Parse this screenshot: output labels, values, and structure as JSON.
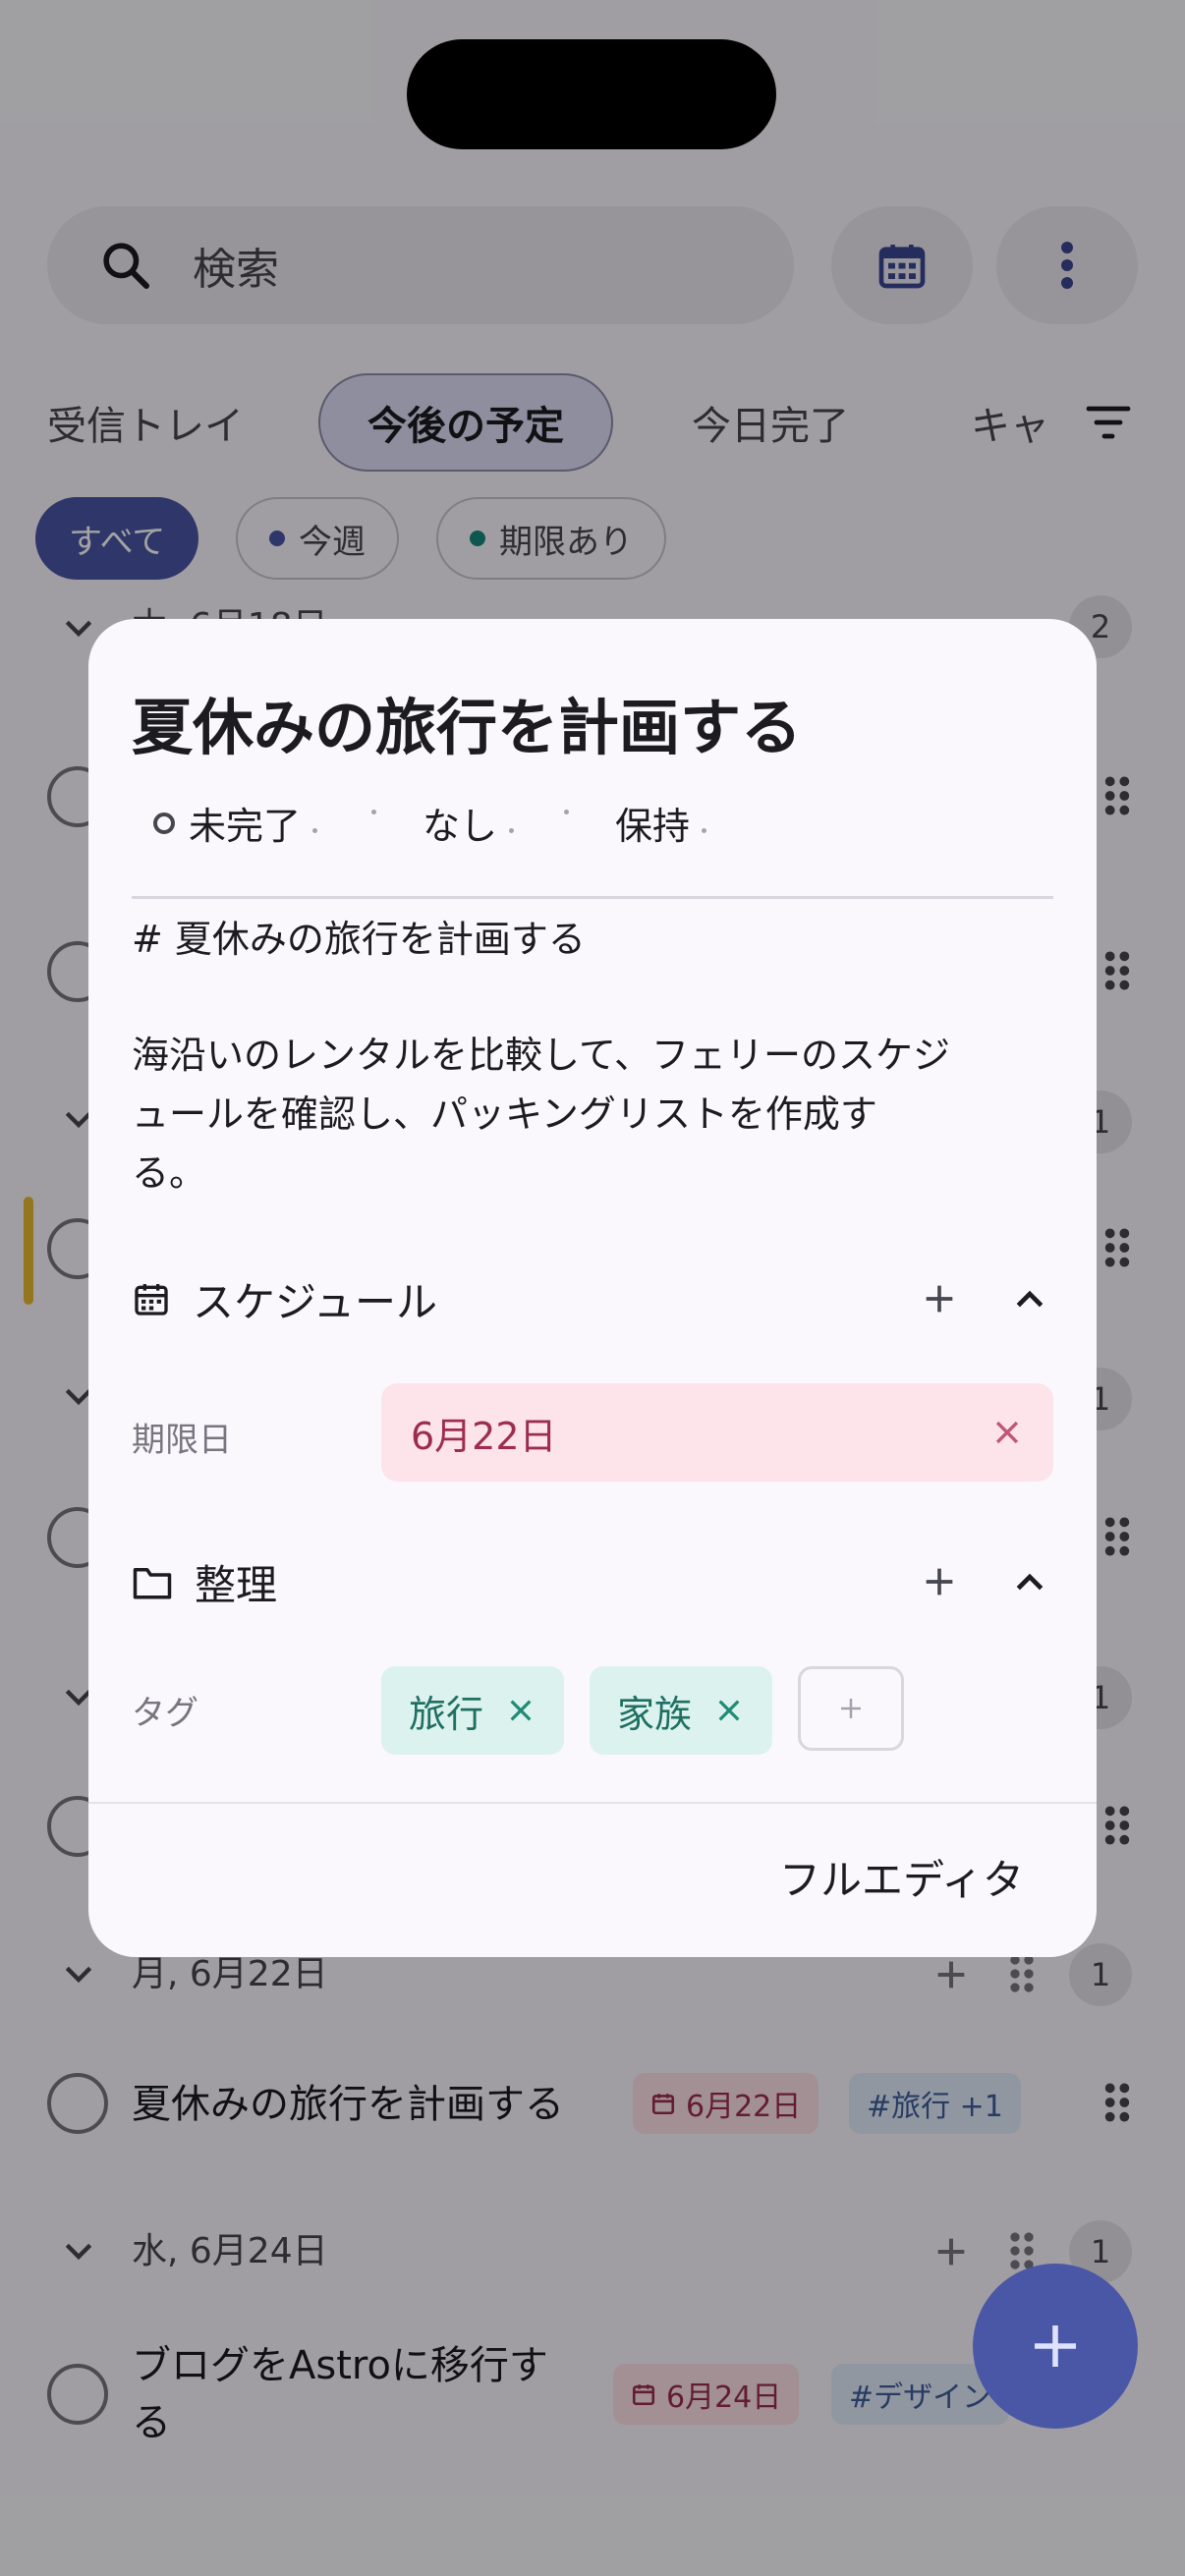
{
  "app": {
    "search": {
      "placeholder": "検索"
    },
    "tabs": [
      {
        "label": "受信トレイ",
        "active": false
      },
      {
        "label": "今後の予定",
        "active": true
      },
      {
        "label": "今日完了",
        "active": false
      },
      {
        "label": "キャ",
        "active": false
      }
    ],
    "filters": [
      {
        "label": "すべて",
        "selected": true
      },
      {
        "label": "今週",
        "dot_color": "#4a56a6"
      },
      {
        "label": "期限あり",
        "dot_color": "#16897a"
      }
    ],
    "sections": [
      {
        "label": "木, 6月18日",
        "count": "2"
      },
      {
        "label": "",
        "count": "1"
      },
      {
        "label": "",
        "count": "1"
      },
      {
        "label": "",
        "count": "1"
      },
      {
        "label": "月, 6月22日",
        "count": "1",
        "task": {
          "title": "夏休みの旅行を計画する",
          "date": "6月22日",
          "tag": "#旅行 +1"
        }
      },
      {
        "label": "水, 6月24日",
        "count": "1",
        "task": {
          "title_line1": "ブログをAstroに移行す",
          "title_line2": "る",
          "date": "6月24日",
          "tag": "#デザイン"
        }
      }
    ]
  },
  "dialog": {
    "title": "夏休みの旅行を計画する",
    "status": "未完了",
    "priority": "なし",
    "list": "保持",
    "heading_line": "# 夏休みの旅行を計画する",
    "description_line1": "海沿いのレンタルを比較して、フェリーのスケジ",
    "description_line2": "ュールを確認し、パッキングリストを作成す",
    "description_line3": "る。",
    "schedule": {
      "title": "スケジュール",
      "due_label": "期限日",
      "due_value": "6月22日"
    },
    "organize": {
      "title": "整理",
      "tags_label": "タグ",
      "tags": [
        "旅行",
        "家族"
      ]
    },
    "footer_button": "フルエディタ"
  },
  "colors": {
    "accent": "#4a56a6",
    "due_bg": "#fce4ea",
    "due_text": "#9c2c52",
    "tag_bg": "#dcf2ee",
    "tag_text": "#1f6f62"
  },
  "icons": [
    "search-icon",
    "calendar-icon",
    "more-vert-icon",
    "filter-icon",
    "chevron-down-icon",
    "plus-icon",
    "drag-handle-icon",
    "chevron-up-icon",
    "folder-icon",
    "close-icon",
    "add-icon"
  ]
}
